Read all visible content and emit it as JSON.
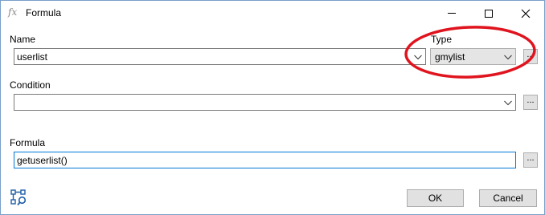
{
  "window": {
    "title": "Formula",
    "app_icon_text": "fx",
    "controls": {
      "minimize": "minimize",
      "maximize": "maximize",
      "close": "close"
    }
  },
  "form": {
    "name": {
      "label": "Name",
      "value": "userlist"
    },
    "type": {
      "label": "Type",
      "value": "gmylist"
    },
    "condition": {
      "label": "Condition",
      "value": ""
    },
    "formula": {
      "label": "Formula",
      "value": "getuserlist()"
    },
    "ellipsis": "..."
  },
  "buttons": {
    "ok_label": "OK",
    "cancel_label": "Cancel"
  },
  "annotation": {
    "color": "#e0141e",
    "shape": "ellipse"
  },
  "colors": {
    "focus_border": "#0078d7",
    "button_bg": "#e1e1e1",
    "select_bg": "#e5e5e5"
  }
}
